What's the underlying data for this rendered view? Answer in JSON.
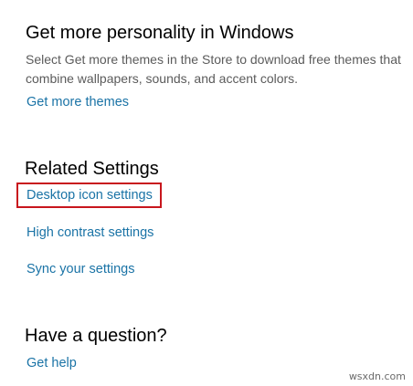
{
  "personality": {
    "title": "Get more personality in Windows",
    "description": "Select Get more themes in the Store to download free themes that combine wallpapers, sounds, and accent colors.",
    "link_label": "Get more themes"
  },
  "related_settings": {
    "title": "Related Settings",
    "links": [
      {
        "label": "Desktop icon settings"
      },
      {
        "label": "High contrast settings"
      },
      {
        "label": "Sync your settings"
      }
    ],
    "highlight_color": "#c8161d"
  },
  "question": {
    "title": "Have a question?",
    "link_label": "Get help"
  },
  "watermark": "wsxdn.com",
  "colors": {
    "link": "#1a73a6",
    "heading": "#000000",
    "description": "#5b5b5b"
  }
}
